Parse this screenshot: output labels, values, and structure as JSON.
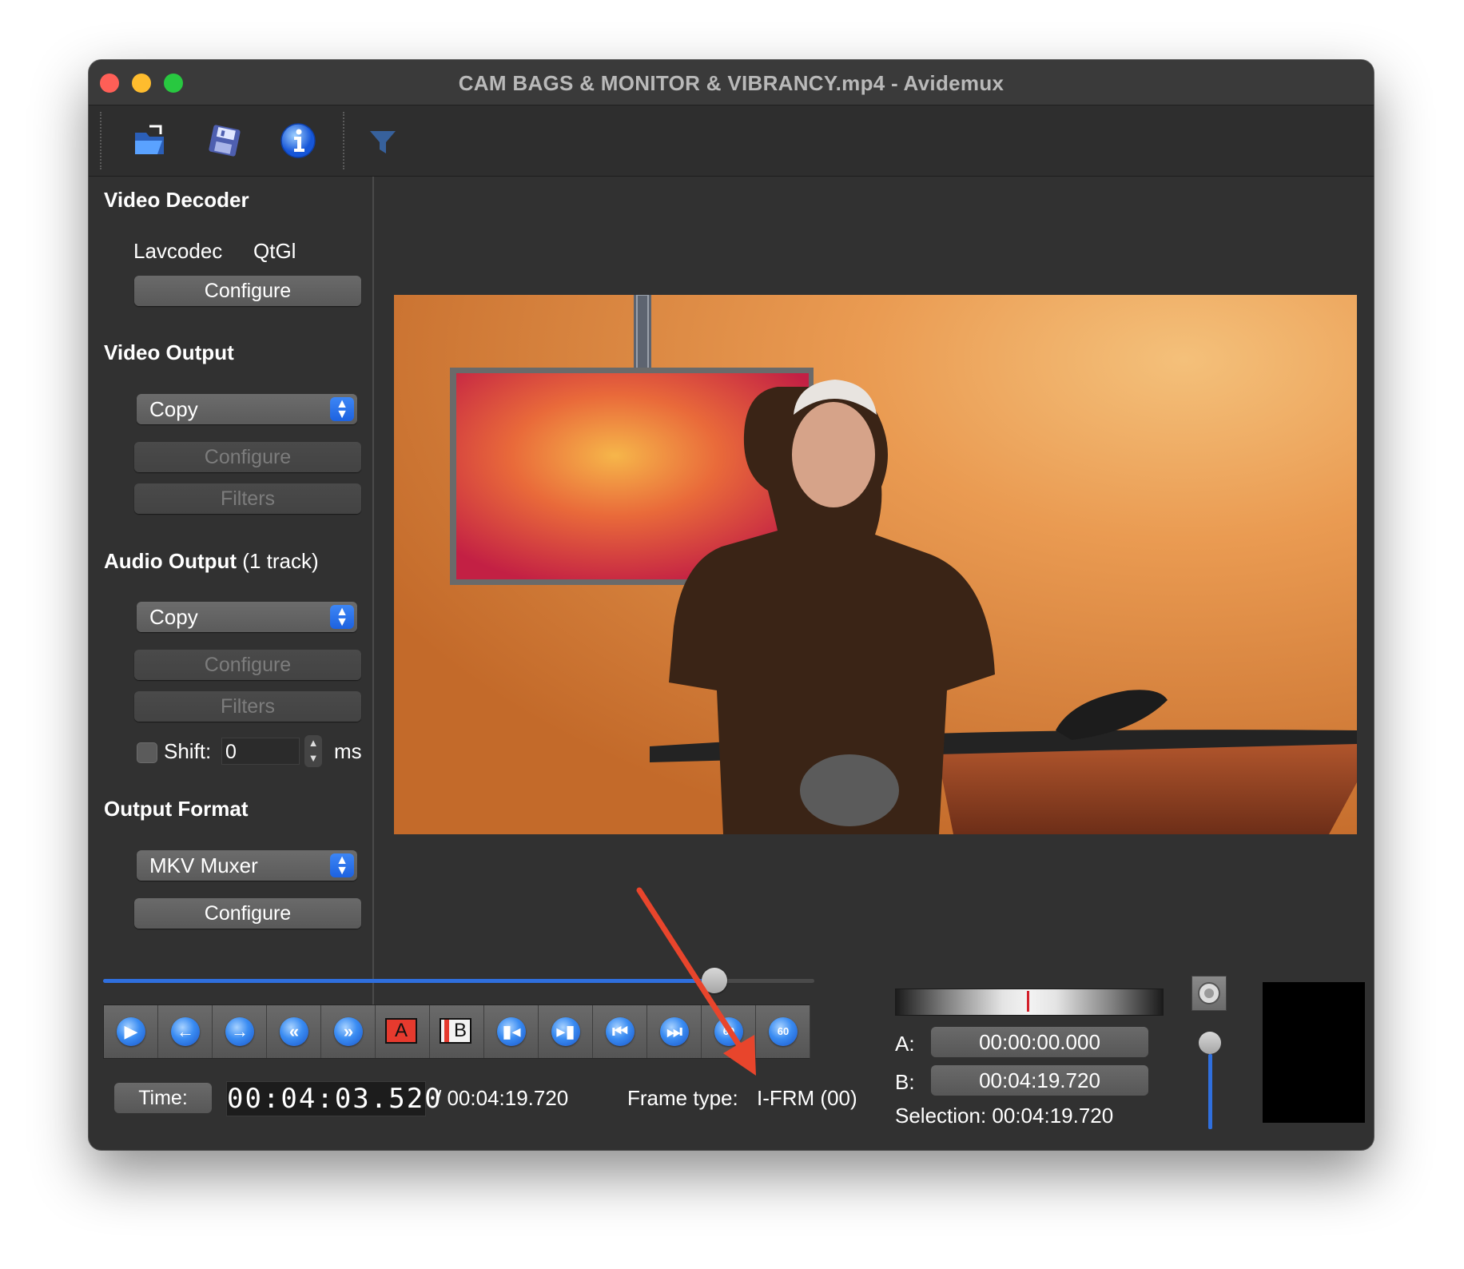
{
  "window": {
    "title": "CAM BAGS & MONITOR & VIBRANCY.mp4 - Avidemux"
  },
  "toolbar": {
    "icons": [
      "open-folder-icon",
      "save-floppy-icon",
      "info-icon",
      "filter-funnel-icon"
    ]
  },
  "video_decoder": {
    "title": "Video Decoder",
    "decoder_name": "Lavcodec",
    "renderer_name": "QtGl",
    "configure_label": "Configure"
  },
  "video_output": {
    "title": "Video Output",
    "selected": "Copy",
    "configure_label": "Configure",
    "filters_label": "Filters"
  },
  "audio_output": {
    "title": "Audio Output",
    "track_info": "(1 track)",
    "selected": "Copy",
    "configure_label": "Configure",
    "filters_label": "Filters",
    "shift_label": "Shift:",
    "shift_value": "0",
    "shift_unit": "ms"
  },
  "output_format": {
    "title": "Output Format",
    "selected": "MKV Muxer",
    "configure_label": "Configure"
  },
  "playback": {
    "position_fraction": 0.86,
    "time_button_label": "Time:",
    "current_time": "00:04:03.520",
    "total_time": "/ 00:04:19.720",
    "frame_type_label": "Frame type:",
    "frame_type_value": "I-FRM (00)",
    "controls": [
      "play-icon",
      "previous-frame-icon",
      "next-frame-icon",
      "rewind-keyframe-icon",
      "forward-keyframe-icon",
      "set-marker-a-icon",
      "set-marker-b-icon",
      "goto-marker-a-icon",
      "goto-marker-b-icon",
      "goto-start-icon",
      "goto-end-icon",
      "back-60s-icon",
      "forward-60s-icon"
    ],
    "marker_a_glyph": "A",
    "marker_b_glyph": "B",
    "seek_60_glyph": "60"
  },
  "selection": {
    "a_label": "A:",
    "a_value": "00:00:00.000",
    "b_label": "B:",
    "b_value": "00:04:19.720",
    "selection_text": "Selection: 00:04:19.720"
  },
  "volume": {
    "level_fraction": 1.0
  },
  "colors": {
    "accent_blue": "#2f6fde",
    "annotation_arrow": "#e8452c",
    "window_bg": "#313131"
  }
}
